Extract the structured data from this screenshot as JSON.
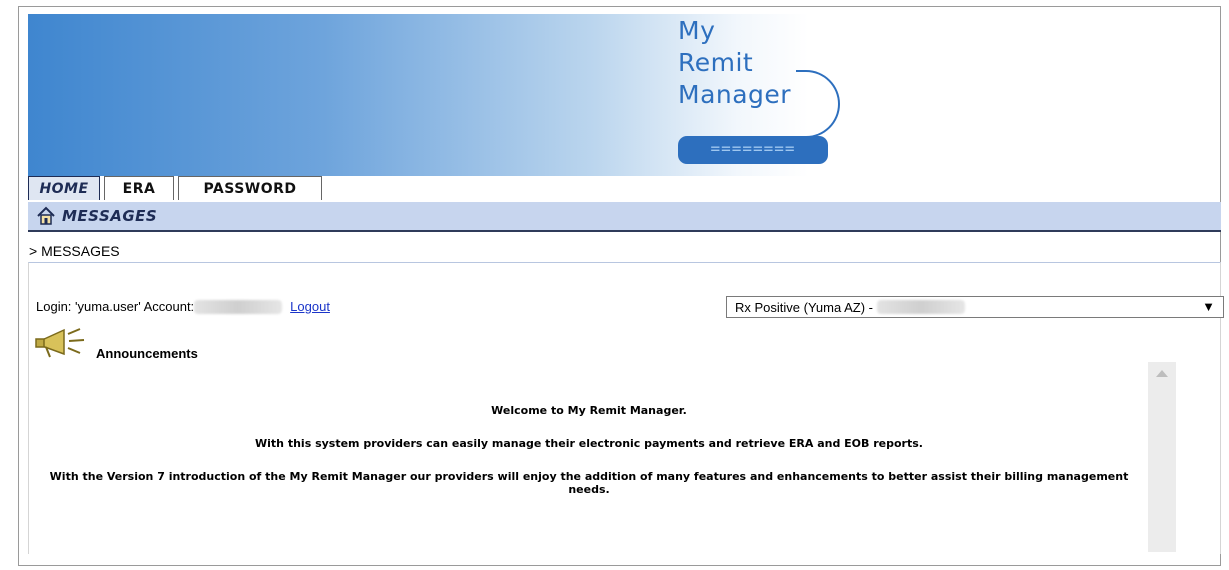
{
  "logo": {
    "line1": "My",
    "line2": "Remit",
    "line3": "Manager",
    "bar": "========"
  },
  "tabs": [
    {
      "label": "HOME",
      "active": true
    },
    {
      "label": "ERA",
      "active": false
    },
    {
      "label": "PASSWORD",
      "active": false
    }
  ],
  "section": {
    "title": "MESSAGES",
    "breadcrumb": "> MESSAGES"
  },
  "login": {
    "text": "Login: 'yuma.user' Account:",
    "logout_label": "Logout"
  },
  "provider_select": {
    "selected": "Rx Positive (Yuma AZ) -",
    "arrow": "▼"
  },
  "announcements": {
    "label": "Announcements",
    "messages": [
      "Welcome to My Remit Manager.",
      "With this system providers can easily manage their electronic payments and retrieve ERA and EOB reports.",
      "With the Version 7 introduction of the My Remit Manager our providers will enjoy the addition of many features and enhancements to better assist their billing management needs."
    ]
  },
  "colors": {
    "brand_blue": "#2d6fbe",
    "tab_bar": "#c7d5ee",
    "link": "#1b35c9"
  }
}
